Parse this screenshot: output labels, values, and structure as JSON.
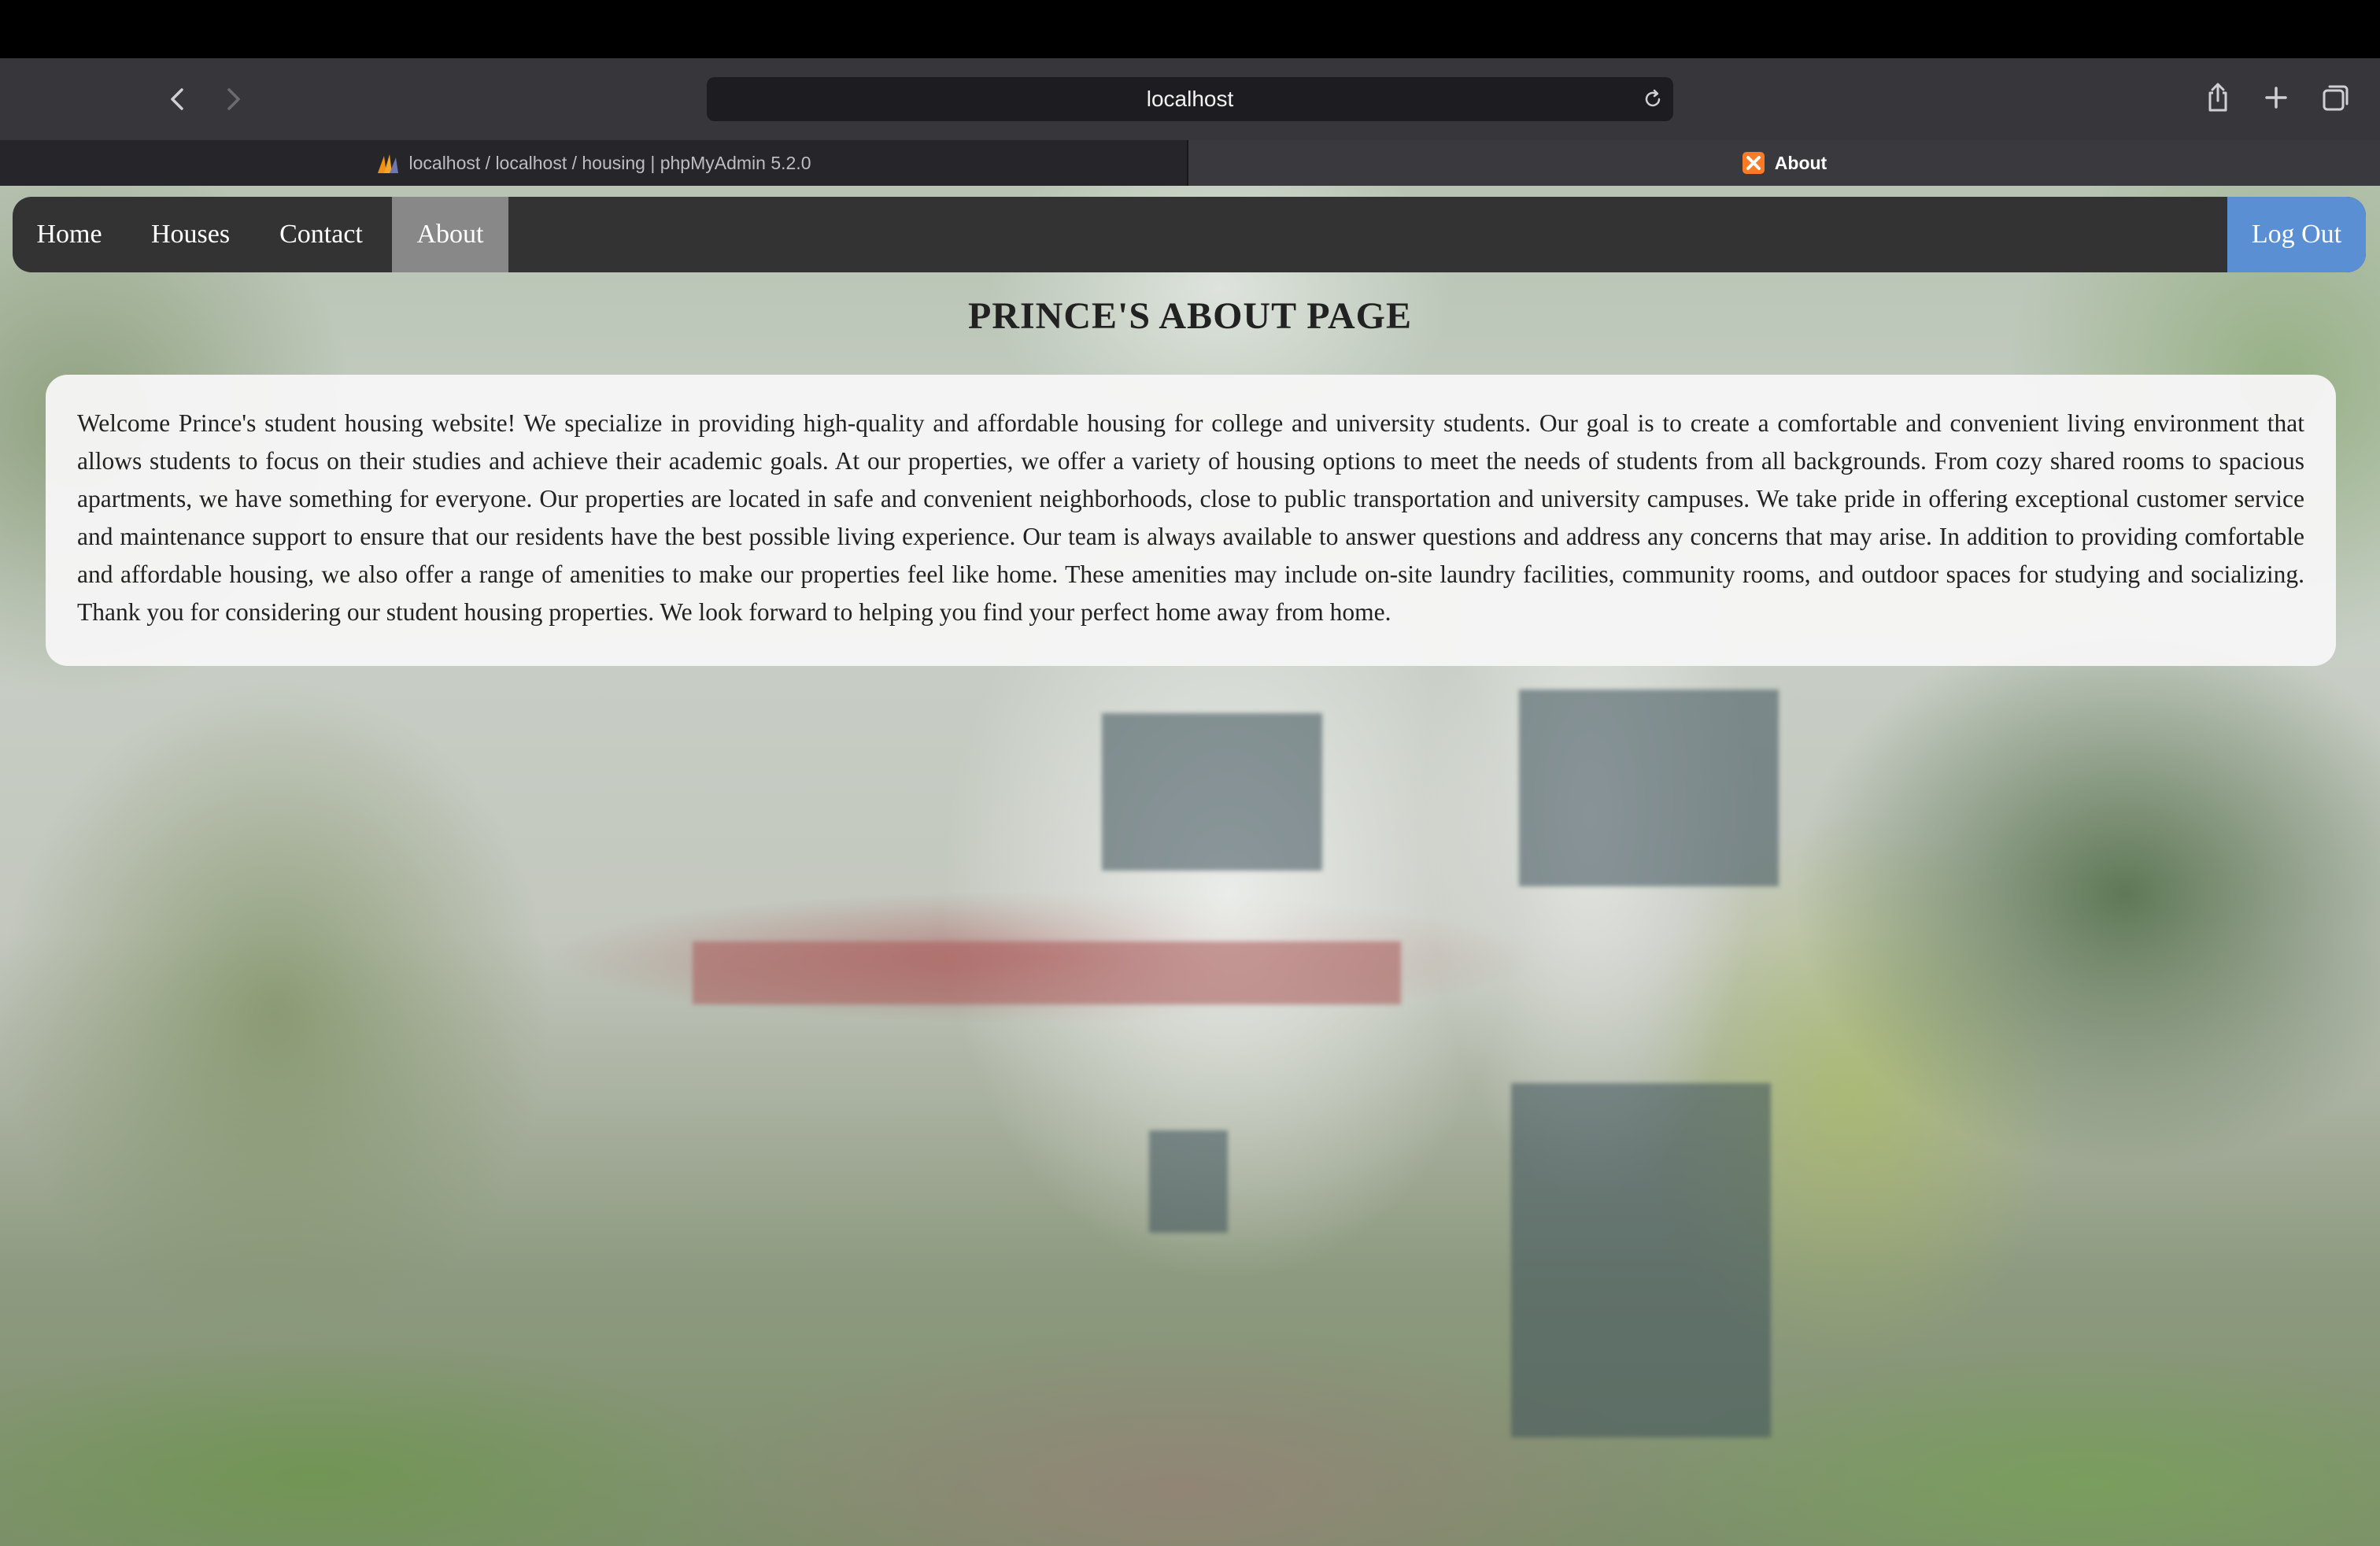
{
  "browser": {
    "url": "localhost",
    "tabs": [
      {
        "label": "localhost / localhost / housing | phpMyAdmin 5.2.0",
        "favicon": "phpmyadmin-icon",
        "active": false
      },
      {
        "label": "About",
        "favicon": "xampp-icon",
        "active": true
      }
    ],
    "icons": [
      "back-icon",
      "forward-icon",
      "reload-icon",
      "share-icon",
      "new-tab-icon",
      "tab-overview-icon"
    ]
  },
  "navbar": {
    "links": [
      {
        "label": "Home"
      },
      {
        "label": "Houses"
      },
      {
        "label": "Contact"
      },
      {
        "label": "About",
        "active": true
      }
    ],
    "logout_label": "Log Out",
    "colors": {
      "bar": "#333333",
      "active": "#888888",
      "logout": "#5b8fd4"
    }
  },
  "page": {
    "title": "PRINCE'S ABOUT PAGE",
    "body": "Welcome Prince's student housing website! We specialize in providing high-quality and affordable housing for college and university students. Our goal is to create a comfortable and convenient living environment that allows students to focus on their studies and achieve their academic goals. At our properties, we offer a variety of housing options to meet the needs of students from all backgrounds. From cozy shared rooms to spacious apartments, we have something for everyone. Our properties are located in safe and convenient neighborhoods, close to public transportation and university campuses. We take pride in offering exceptional customer service and maintenance support to ensure that our residents have the best possible living experience. Our team is always available to answer questions and address any concerns that may arise. In addition to providing comfortable and affordable housing, we also offer a range of amenities to make our properties feel like home. These amenities may include on-site laundry facilities, community rooms, and outdoor spaces for studying and socializing. Thank you for considering our student housing properties. We look forward to helping you find your perfect home away from home."
  }
}
